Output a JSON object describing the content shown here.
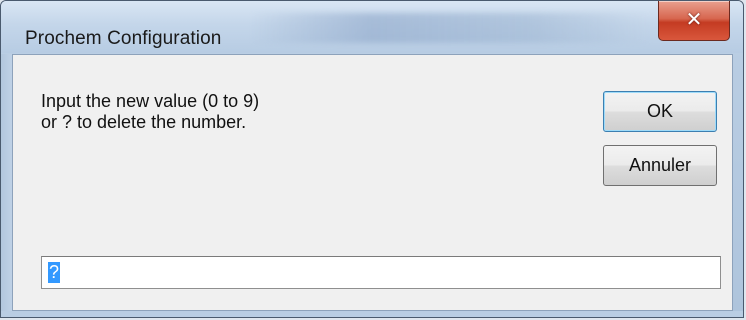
{
  "window": {
    "title": "Prochem Configuration",
    "close_glyph": "✕"
  },
  "dialog": {
    "prompt_line1": "Input the new value (0 to 9)",
    "prompt_line2": "or ? to delete the number.",
    "ok_label": "OK",
    "cancel_label": "Annuler",
    "input_value": "?"
  },
  "colors": {
    "selection": "#3399ff",
    "close_button": "#c43b22",
    "frame": "#b9cde3"
  }
}
